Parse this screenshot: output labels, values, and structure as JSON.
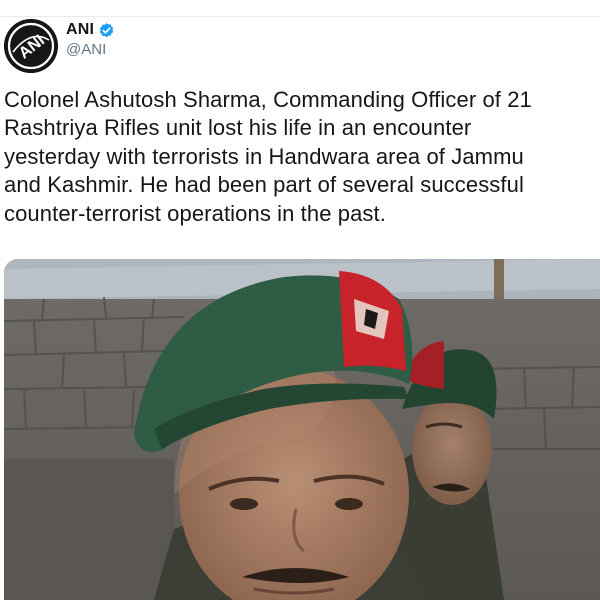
{
  "author": {
    "display_name": "ANI",
    "handle": "@ANI",
    "verified": true,
    "avatar_icon": "ani-logo-icon",
    "avatar_text": "ANI"
  },
  "tweet": {
    "text": "Colonel Ashutosh Sharma, Commanding Officer of 21\nRashtriya Rifles unit lost his life in an encounter\nyesterday with terrorists in Handwara area of Jammu\nand Kashmir. He had been part of several successful\ncounter-terrorist operations in the past."
  },
  "media": {
    "icon": "photo-icon"
  },
  "colors": {
    "verified_badge": "#1da1f2",
    "text": "#14171a",
    "handle": "#657786",
    "beret_green": "#2e5a43",
    "beret_badge_red": "#c8232a"
  }
}
